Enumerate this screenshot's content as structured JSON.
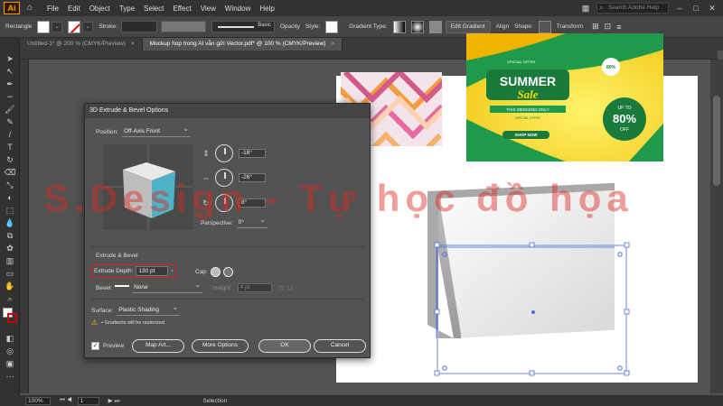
{
  "menubar": {
    "logo": "Ai",
    "items": [
      "File",
      "Edit",
      "Object",
      "Type",
      "Select",
      "Effect",
      "View",
      "Window",
      "Help"
    ],
    "search_placeholder": "Search Adobe Help"
  },
  "controlbar": {
    "tool_name": "Rectangle",
    "stroke_label": "Stroke:",
    "brush_label": "Basic",
    "opacity_label": "Opacity",
    "style_label": "Style:",
    "gradient_type_label": "Gradient Type:",
    "edit_gradient": "Edit Gradient",
    "align": "Align",
    "shape": "Shape:",
    "transform": "Transform"
  },
  "tabs": [
    {
      "label": "Untitled-1* @ 200 % (CMYK/Preview)",
      "active": false
    },
    {
      "label": "Mockup hop trong AI vẫn gửi Vector.pdf* @ 100 % (CMYK/Preview)",
      "active": true
    }
  ],
  "dialog": {
    "title": "3D Extrude & Bevel Options",
    "position_label": "Position:",
    "position_value": "Off-Axis Front",
    "rot_x": "-18°",
    "rot_y": "-26°",
    "rot_z": "8°",
    "perspective_label": "Perspective:",
    "perspective_value": "0°",
    "extrude_section": "Extrude & Bevel",
    "extrude_depth_label": "Extrude Depth:",
    "extrude_depth_value": "130 pt",
    "cap_label": "Cap:",
    "bevel_label": "Bevel:",
    "bevel_value": "None",
    "height_label": "Height:",
    "height_value": "4 pt",
    "surface_label": "Surface:",
    "surface_value": "Plastic Shading",
    "warning": "• Gradients will be rasterized.",
    "preview_label": "Preview",
    "preview_checked": true,
    "map_art": "Map Art...",
    "more_options": "More Options",
    "ok": "OK",
    "cancel": "Cancel"
  },
  "artboard": {
    "summer": {
      "top_small": "SPECIAL OFFER",
      "title1": "SUMMER",
      "title2": "Sale",
      "line1": "THIS WEEKEND ONLY",
      "line2": "SPECIAL OFFER",
      "button": "SHOP NOW",
      "badge_small": "80%",
      "upto": "UP TO",
      "big": "80%",
      "off": "OFF"
    }
  },
  "watermark": "S.Design - Tự học đồ họa",
  "status": {
    "zoom": "100%",
    "page": "1",
    "selection": "Selection"
  },
  "colors": {
    "accent_red": "#e02020",
    "summer_yellow": "#f5d90a",
    "summer_green": "#1f9a4a",
    "cube_face": "#4fb3c8"
  }
}
